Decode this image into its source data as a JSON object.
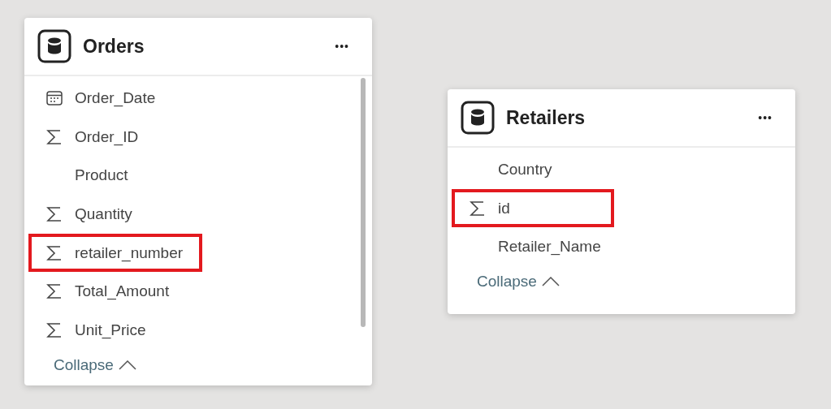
{
  "tables": [
    {
      "title": "Orders",
      "more": "•••",
      "scrollable": true,
      "fields": [
        {
          "name": "Order_Date",
          "kind": "date",
          "highlighted": false
        },
        {
          "name": "Order_ID",
          "kind": "sum",
          "highlighted": false
        },
        {
          "name": "Product",
          "kind": "text",
          "highlighted": false
        },
        {
          "name": "Quantity",
          "kind": "sum",
          "highlighted": false
        },
        {
          "name": "retailer_number",
          "kind": "sum",
          "highlighted": true
        },
        {
          "name": "Total_Amount",
          "kind": "sum",
          "highlighted": false
        },
        {
          "name": "Unit_Price",
          "kind": "sum",
          "highlighted": false
        }
      ],
      "collapse": "Collapse"
    },
    {
      "title": "Retailers",
      "more": "•••",
      "scrollable": false,
      "fields": [
        {
          "name": "Country",
          "kind": "text",
          "highlighted": false
        },
        {
          "name": "id",
          "kind": "sum",
          "highlighted": true
        },
        {
          "name": "Retailer_Name",
          "kind": "text",
          "highlighted": false
        }
      ],
      "collapse": "Collapse"
    }
  ]
}
